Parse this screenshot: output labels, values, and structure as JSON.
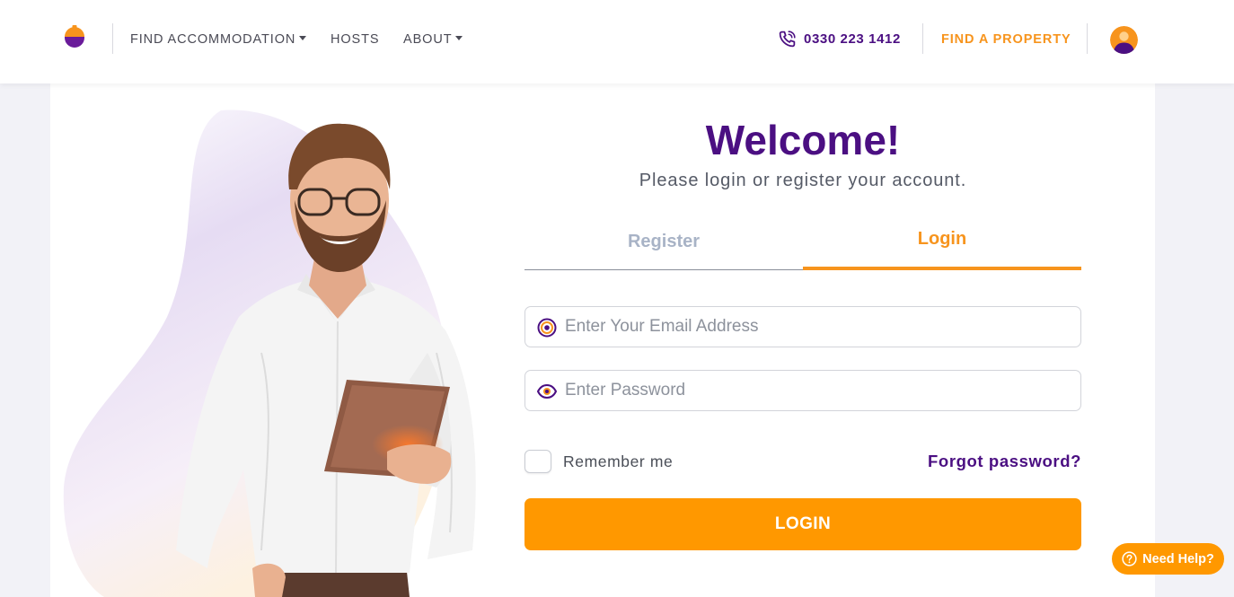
{
  "header": {
    "nav": [
      {
        "label": "FIND ACCOMMODATION"
      },
      {
        "label": "HOSTS"
      },
      {
        "label": "ABOUT"
      }
    ],
    "phone": "0330 223 1412",
    "find_property": "FIND A PROPERTY"
  },
  "login": {
    "title": "Welcome!",
    "subtitle": "Please login or register your account.",
    "tabs": {
      "register": "Register",
      "login": "Login",
      "active": "login"
    },
    "email_placeholder": "Enter Your Email Address",
    "password_placeholder": "Enter Password",
    "remember_label": "Remember me",
    "remember_checked": false,
    "forgot_label": "Forgot password?",
    "submit_label": "LOGIN"
  },
  "help": {
    "label": "Need Help?"
  },
  "icons": {
    "logo": "helmet-logo-icon",
    "phone": "phone-call-icon",
    "avatar": "user-avatar-icon",
    "email": "at-sign-icon",
    "password": "eye-icon",
    "help": "question-circle-icon"
  },
  "colors": {
    "brand_purple": "#4b0f82",
    "brand_orange": "#f7941d",
    "button_orange": "#ff9800",
    "tab_inactive": "#a8b3c6",
    "page_bg": "#f2f2f7"
  }
}
